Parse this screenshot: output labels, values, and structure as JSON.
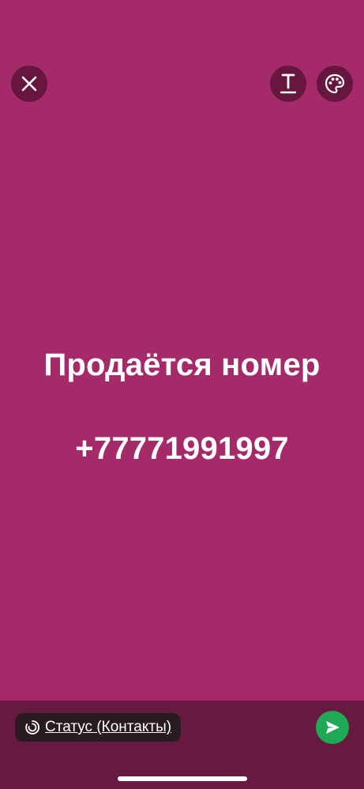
{
  "colors": {
    "background": "#a52a6a",
    "button_bg": "#66163f",
    "bottom_bar": "#661a40",
    "chip_bg": "#2a1a22",
    "send": "#1fa855",
    "text": "#ffffff"
  },
  "toolbar": {
    "close_icon": "close-icon",
    "text_icon": "text-format-icon",
    "palette_icon": "palette-icon"
  },
  "status": {
    "line1": "Продаётся номер",
    "line2": "+77771991997"
  },
  "footer": {
    "audience_label": "Статус (Контакты)",
    "audience_icon": "status-ring-icon",
    "send_icon": "send-icon"
  }
}
